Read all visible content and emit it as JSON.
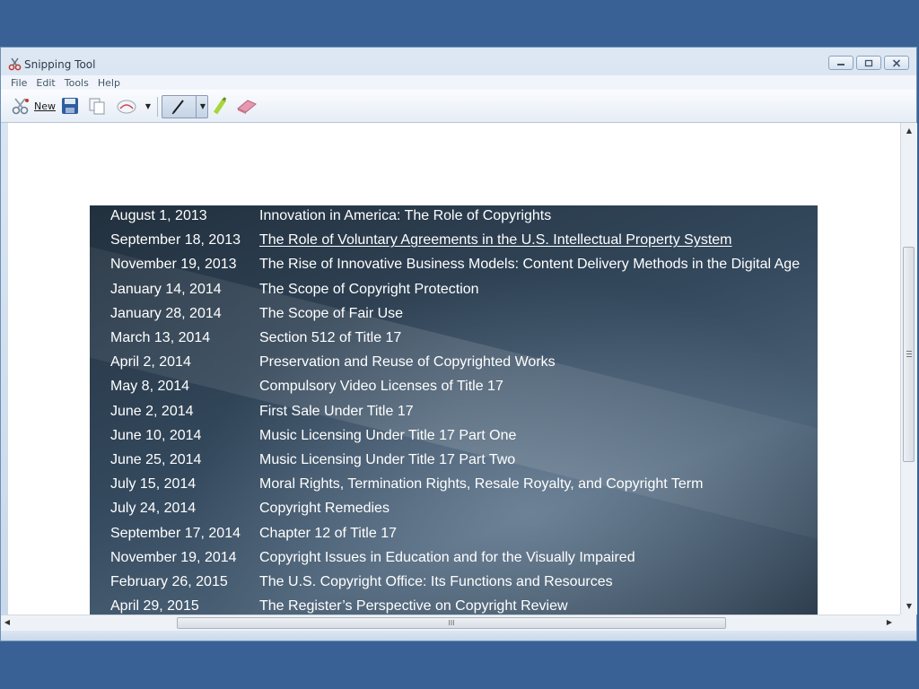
{
  "window": {
    "title": "Snipping Tool"
  },
  "menu": {
    "items": [
      "File",
      "Edit",
      "Tools",
      "Help"
    ]
  },
  "toolbar": {
    "new_label": "New"
  },
  "scrollbar": {
    "grip": "III"
  },
  "schedule": [
    {
      "date": "August 1, 2013",
      "topic": "Innovation in America: The Role of Copyrights"
    },
    {
      "date": "September 18, 2013",
      "topic": "The Role of Voluntary Agreements in the U.S. Intellectual Property System"
    },
    {
      "date": "November 19, 2013",
      "topic": "The Rise of Innovative Business Models: Content Delivery Methods in the Digital Age"
    },
    {
      "date": "January 14, 2014",
      "topic": "The Scope of Copyright Protection"
    },
    {
      "date": "January 28, 2014",
      "topic": "The Scope of Fair Use"
    },
    {
      "date": "March 13, 2014",
      "topic": "Section 512 of Title 17"
    },
    {
      "date": "April 2, 2014",
      "topic": "Preservation and Reuse of Copyrighted Works"
    },
    {
      "date": "May 8, 2014",
      "topic": "Compulsory Video Licenses of Title 17"
    },
    {
      "date": "June 2, 2014",
      "topic": "First Sale Under Title 17"
    },
    {
      "date": "June 10, 2014",
      "topic": "Music Licensing Under Title 17 Part One"
    },
    {
      "date": "June 25, 2014",
      "topic": "Music Licensing Under Title 17 Part Two"
    },
    {
      "date": "July 15, 2014",
      "topic": "Moral Rights, Termination Rights, Resale Royalty, and Copyright Term"
    },
    {
      "date": "July 24, 2014",
      "topic": "Copyright Remedies"
    },
    {
      "date": "September 17, 2014",
      "topic": "Chapter 12 of Title 17"
    },
    {
      "date": "November 19, 2014",
      "topic": "Copyright Issues in Education and for the Visually Impaired"
    },
    {
      "date": "February 26, 2015",
      "topic": "The U.S. Copyright Office: Its Functions and Resources"
    },
    {
      "date": "April 29, 2015",
      "topic": "The Register’s Perspective on Copyright Review"
    }
  ],
  "colors": {
    "desktop": "#3a6195",
    "snip_bg": "#34495d"
  }
}
